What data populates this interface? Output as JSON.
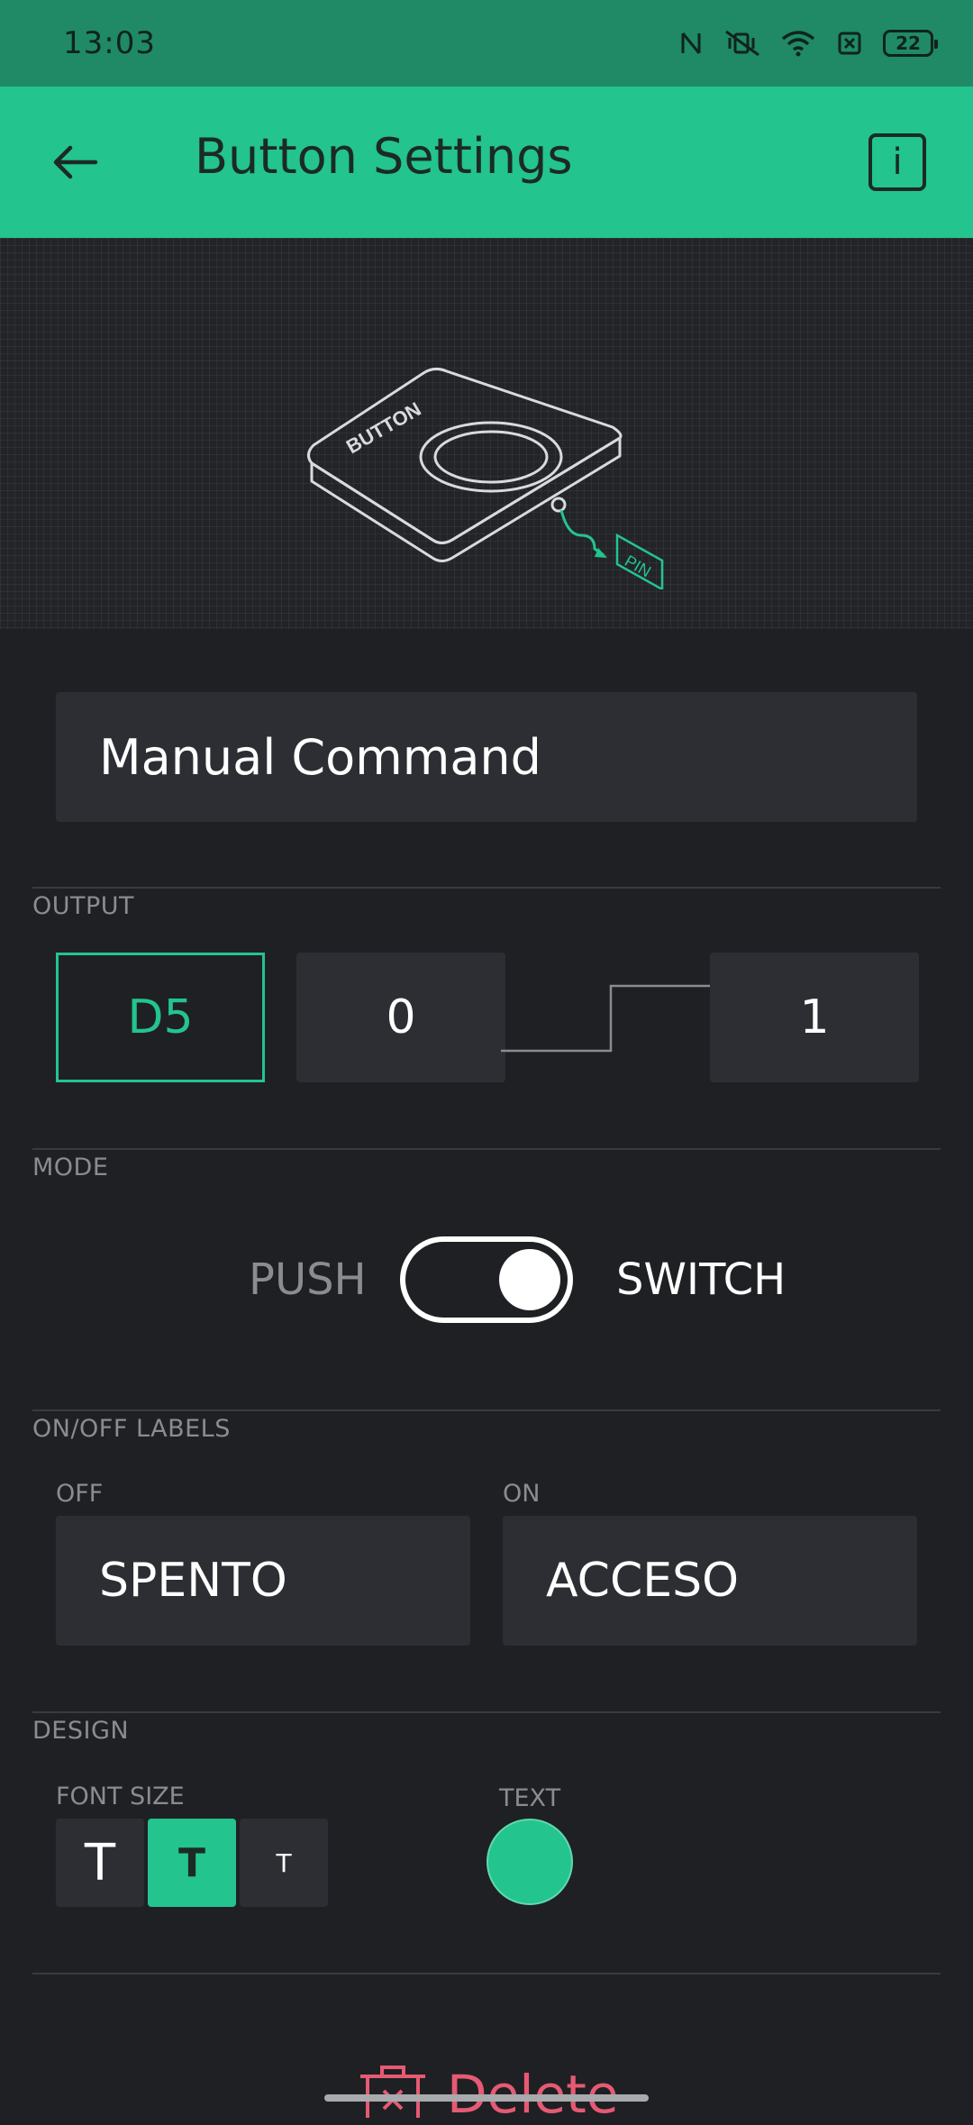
{
  "status_bar": {
    "time": "13:03",
    "battery": "22",
    "icons": [
      "nfc-icon",
      "vibrate-off-icon",
      "wifi-icon",
      "sim-off-icon",
      "battery-icon"
    ]
  },
  "app_bar": {
    "title": "Button Settings",
    "back_icon": "arrow-left-icon",
    "info_label": "i"
  },
  "hero": {
    "device_label": "BUTTON",
    "pin_label": "PIN"
  },
  "name_field": {
    "value": "Manual Command"
  },
  "output": {
    "section_label": "OUTPUT",
    "pin": "D5",
    "low_value": "0",
    "high_value": "1"
  },
  "mode": {
    "section_label": "MODE",
    "push_label": "PUSH",
    "switch_label": "SWITCH",
    "selected": "SWITCH"
  },
  "labels": {
    "section_label": "ON/OFF LABELS",
    "off_caption": "OFF",
    "on_caption": "ON",
    "off_value": "SPENTO",
    "on_value": "ACCESO"
  },
  "design": {
    "section_label": "DESIGN",
    "font_size_caption": "FONT SIZE",
    "text_caption": "TEXT",
    "font_sizes": [
      "T",
      "T",
      "T"
    ],
    "selected_font_size_index": 1,
    "text_color": "#23c48e"
  },
  "delete": {
    "label": "Delete"
  },
  "colors": {
    "accent": "#23c48e",
    "status_bar": "#1f8a65",
    "background": "#1f2024",
    "danger": "#e65a73"
  }
}
